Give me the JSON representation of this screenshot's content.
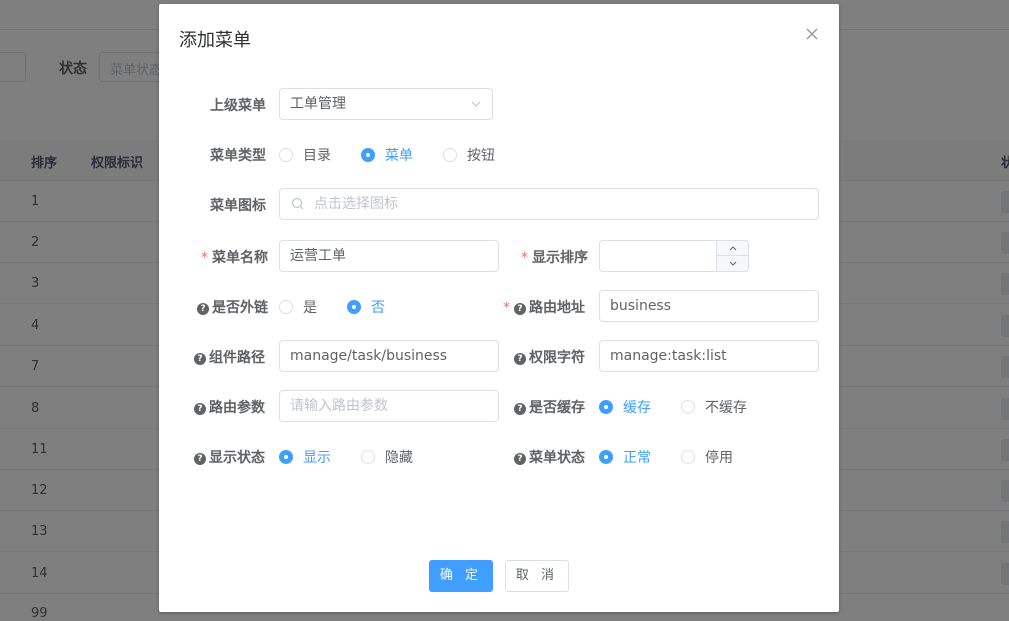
{
  "background": {
    "status_label": "状态",
    "status_placeholder": "菜单状态",
    "table_headers": [
      "排序",
      "权限标识"
    ],
    "row_sorts": [
      "1",
      "2",
      "3",
      "4",
      "7",
      "8",
      "11",
      "12",
      "13",
      "14",
      "99"
    ],
    "right_header_fragment": "状"
  },
  "dialog": {
    "title": "添加菜单",
    "close_icon": "close-icon",
    "labels": {
      "parent_menu": "上级菜单",
      "menu_type": "菜单类型",
      "menu_icon": "菜单图标",
      "menu_name": "菜单名称",
      "sort_order": "显示排序",
      "is_external": "是否外链",
      "route_path": "路由地址",
      "component_path": "组件路径",
      "permission": "权限字符",
      "route_params": "路由参数",
      "is_cache": "是否缓存",
      "visible": "显示状态",
      "menu_status": "菜单状态"
    },
    "fields": {
      "parent_menu_value": "工单管理",
      "menu_icon_placeholder": "点击选择图标",
      "menu_name_value": "运营工单",
      "sort_order_value": "",
      "route_path_value": "business",
      "component_path_value": "manage/task/business",
      "permission_value": "manage:task:list",
      "route_params_placeholder": "请输入路由参数"
    },
    "menu_type_options": [
      {
        "label": "目录",
        "checked": false
      },
      {
        "label": "菜单",
        "checked": true
      },
      {
        "label": "按钮",
        "checked": false
      }
    ],
    "is_external_options": [
      {
        "label": "是",
        "checked": false
      },
      {
        "label": "否",
        "checked": true
      }
    ],
    "is_cache_options": [
      {
        "label": "缓存",
        "checked": true
      },
      {
        "label": "不缓存",
        "checked": false
      }
    ],
    "visible_options": [
      {
        "label": "显示",
        "checked": true
      },
      {
        "label": "隐藏",
        "checked": false
      }
    ],
    "menu_status_options": [
      {
        "label": "正常",
        "checked": true
      },
      {
        "label": "停用",
        "checked": false
      }
    ],
    "buttons": {
      "confirm": "确 定",
      "cancel": "取 消"
    }
  },
  "colors": {
    "primary": "#409eff",
    "required": "#f56c6c"
  }
}
